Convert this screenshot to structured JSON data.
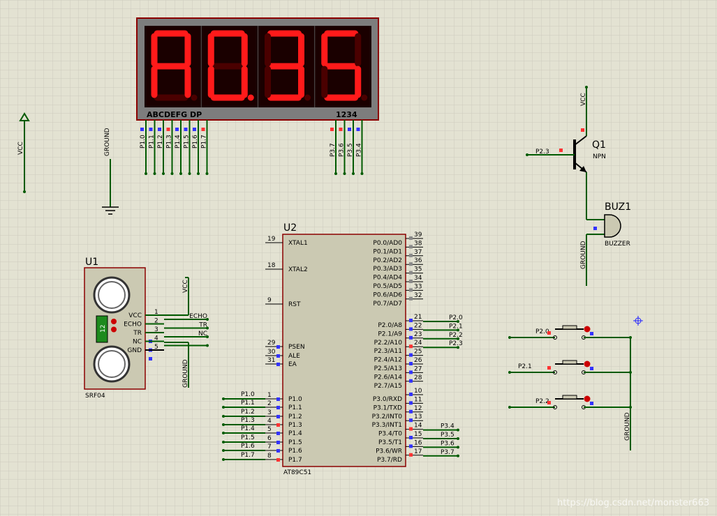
{
  "colors": {
    "background": "#e3e2d2",
    "grid": "#cccbbd",
    "wire": "#005a00",
    "chip_fill": "#cbc9b2",
    "chip_border": "#8b0000",
    "segment_on": "#ff1a1a",
    "segment_off": "#4a0000",
    "display_bg": "#7d7d7d",
    "pin_low": "#3333ff",
    "pin_high": "#ff3333"
  },
  "display": {
    "digits": [
      "A",
      "0.",
      "3",
      "5"
    ],
    "segment_label": "ABCDEFG DP",
    "digit_label": "1234",
    "segment_pins": [
      "P1.0",
      "P1.1",
      "P1.2",
      "P1.3",
      "P1.4",
      "P1.5",
      "P1.6",
      "P1.7"
    ],
    "segment_states": [
      "low",
      "low",
      "low",
      "high",
      "low",
      "low",
      "low",
      "high"
    ],
    "digit_pins": [
      "P3.7",
      "P3.6",
      "P3.5",
      "P3.4"
    ],
    "digit_states": [
      "high",
      "high",
      "low",
      "low"
    ]
  },
  "vcc_terminal": {
    "label": "VCC"
  },
  "ground_left": {
    "label": "GROUND"
  },
  "mcu": {
    "ref": "U2",
    "part": "AT89C51",
    "left_pins": [
      {
        "num": "19",
        "name": "XTAL1"
      },
      {
        "num": "18",
        "name": "XTAL2"
      },
      {
        "num": "9",
        "name": "RST"
      },
      {
        "num": "29",
        "name": "PSEN"
      },
      {
        "num": "30",
        "name": "ALE"
      },
      {
        "num": "31",
        "name": "EA"
      },
      {
        "num": "1",
        "name": "P1.0"
      },
      {
        "num": "2",
        "name": "P1.1"
      },
      {
        "num": "3",
        "name": "P1.2"
      },
      {
        "num": "4",
        "name": "P1.3"
      },
      {
        "num": "5",
        "name": "P1.4"
      },
      {
        "num": "6",
        "name": "P1.5"
      },
      {
        "num": "7",
        "name": "P1.6"
      },
      {
        "num": "8",
        "name": "P1.7"
      }
    ],
    "right_pins": [
      {
        "num": "39",
        "name": "P0.0/AD0"
      },
      {
        "num": "38",
        "name": "P0.1/AD1"
      },
      {
        "num": "37",
        "name": "P0.2/AD2"
      },
      {
        "num": "36",
        "name": "P0.3/AD3"
      },
      {
        "num": "35",
        "name": "P0.4/AD4"
      },
      {
        "num": "34",
        "name": "P0.5/AD5"
      },
      {
        "num": "33",
        "name": "P0.6/AD6"
      },
      {
        "num": "32",
        "name": "P0.7/AD7"
      },
      {
        "num": "21",
        "name": "P2.0/A8"
      },
      {
        "num": "22",
        "name": "P2.1/A9"
      },
      {
        "num": "23",
        "name": "P2.2/A10"
      },
      {
        "num": "24",
        "name": "P2.3/A11"
      },
      {
        "num": "25",
        "name": "P2.4/A12"
      },
      {
        "num": "26",
        "name": "P2.5/A13"
      },
      {
        "num": "27",
        "name": "P2.6/A14"
      },
      {
        "num": "28",
        "name": "P2.7/A15"
      },
      {
        "num": "10",
        "name": "P3.0/RXD"
      },
      {
        "num": "11",
        "name": "P3.1/TXD"
      },
      {
        "num": "12",
        "name": "P3.2/INT0"
      },
      {
        "num": "13",
        "name": "P3.3/INT1"
      },
      {
        "num": "14",
        "name": "P3.4/T0"
      },
      {
        "num": "15",
        "name": "P3.5/T1"
      },
      {
        "num": "16",
        "name": "P3.6/WR"
      },
      {
        "num": "17",
        "name": "P3.7/RD"
      }
    ],
    "p1_nets": [
      "P1.0",
      "P1.1",
      "P1.2",
      "P1.3",
      "P1.4",
      "P1.5",
      "P1.6",
      "P1.7"
    ],
    "p2_nets": [
      "P2.0",
      "P2.1",
      "P2.2",
      "P2.3"
    ],
    "p3_nets": [
      "P3.4",
      "P3.5",
      "P3.6",
      "P3.7"
    ]
  },
  "sensor": {
    "ref": "U1",
    "part": "SRF04",
    "badge": "12",
    "pins": [
      {
        "name": "VCC",
        "num": "1",
        "net": "ECHO"
      },
      {
        "name": "ECHO",
        "num": "2",
        "net": "TR"
      },
      {
        "name": "TR",
        "num": "3",
        "net": "NC"
      },
      {
        "name": "NC",
        "num": "4",
        "net": ""
      },
      {
        "name": "GND",
        "num": "5",
        "net": ""
      }
    ],
    "vcc_label": "VCC",
    "ground_label": "GROUND"
  },
  "transistor": {
    "ref": "Q1",
    "type": "NPN",
    "base_net": "P2.3",
    "vcc_label": "VCC"
  },
  "buzzer": {
    "ref": "BUZ1",
    "part": "BUZZER",
    "ground_label": "GROUND"
  },
  "buttons": [
    {
      "net": "P2.0"
    },
    {
      "net": "P2.1"
    },
    {
      "net": "P2.2"
    }
  ],
  "buttons_ground_label": "GROUND",
  "watermark": "https://blog.csdn.net/monster663"
}
